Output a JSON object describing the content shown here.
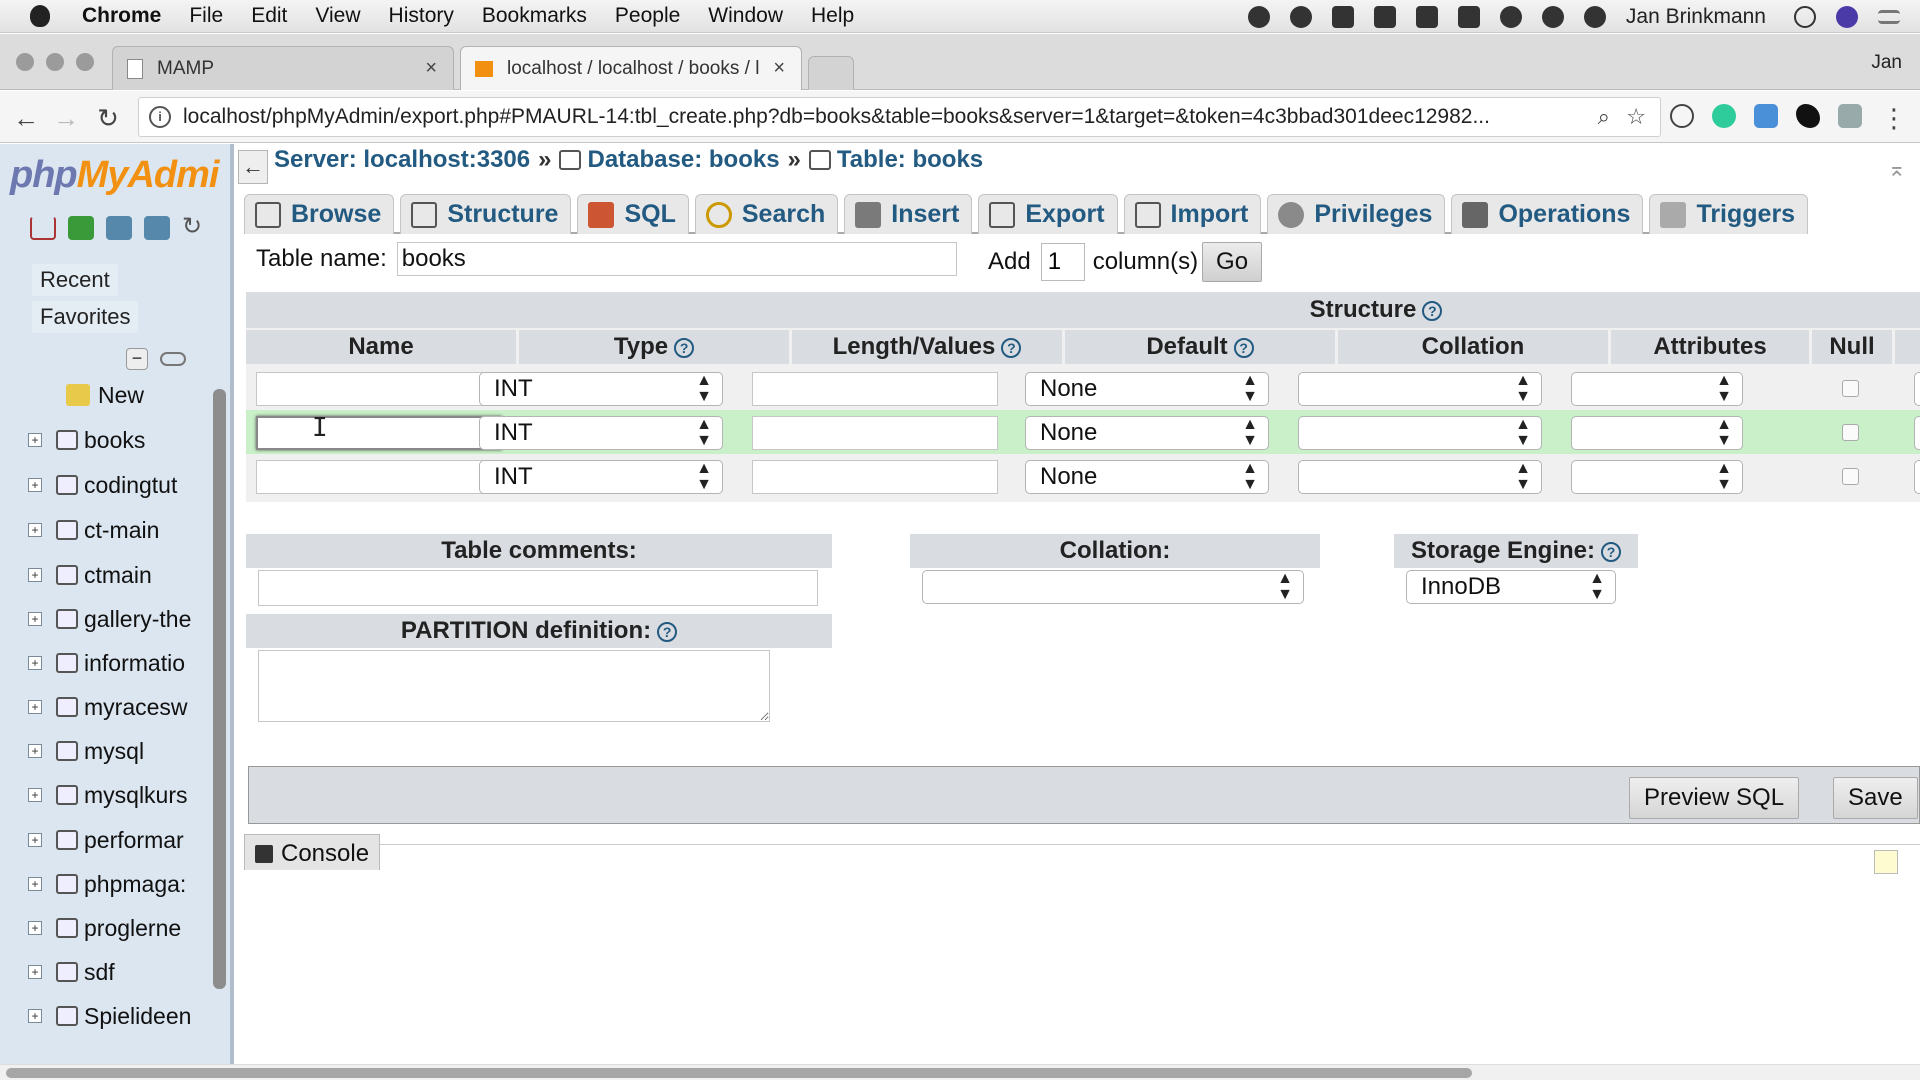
{
  "menubar": {
    "items": [
      "Chrome",
      "File",
      "Edit",
      "View",
      "History",
      "Bookmarks",
      "People",
      "Window",
      "Help"
    ],
    "user": "Jan Brinkmann"
  },
  "browser": {
    "tabs": [
      {
        "title": "MAMP"
      },
      {
        "title": "localhost / localhost / books / l"
      }
    ],
    "profile": "Jan",
    "url": "localhost/phpMyAdmin/export.php#PMAURL-14:tbl_create.php?db=books&table=books&server=1&target=&token=4c3bbad301deec12982..."
  },
  "sidebar": {
    "logo": {
      "php": "php",
      "my": "My",
      "admin": "Admi"
    },
    "recent": "Recent",
    "favorites": "Favorites",
    "new_label": "New",
    "databases": [
      "books",
      "codingtut",
      "ct-main",
      "ctmain",
      "gallery-the",
      "informatio",
      "myracesw",
      "mysql",
      "mysqlkurs",
      "performar",
      "phpmaga:",
      "proglerne",
      "sdf",
      "Spielideen"
    ]
  },
  "breadcrumb": {
    "server": "Server: localhost:3306",
    "database": "Database: books",
    "table": "Table: books",
    "sep": "»"
  },
  "tabs": [
    "Browse",
    "Structure",
    "SQL",
    "Search",
    "Insert",
    "Export",
    "Import",
    "Privileges",
    "Operations",
    "Triggers"
  ],
  "form": {
    "table_name_label": "Table name:",
    "table_name_value": "books",
    "add_label": "Add",
    "add_value": "1",
    "columns_label": "column(s)",
    "go_label": "Go"
  },
  "structure": {
    "title": "Structure",
    "help": "?",
    "headers": [
      "Name",
      "Type",
      "Length/Values",
      "Default",
      "Collation",
      "Attributes",
      "Null"
    ],
    "rows": [
      {
        "name": "",
        "type": "INT",
        "length": "",
        "default": "None",
        "collation": "",
        "attributes": ""
      },
      {
        "name": "",
        "type": "INT",
        "length": "",
        "default": "None",
        "collation": "",
        "attributes": ""
      },
      {
        "name": "",
        "type": "INT",
        "length": "",
        "default": "None",
        "collation": "",
        "attributes": ""
      }
    ]
  },
  "options": {
    "table_comments": "Table comments:",
    "collation": "Collation:",
    "storage_engine": "Storage Engine:",
    "storage_engine_value": "InnoDB",
    "partition": "PARTITION definition:"
  },
  "actions": {
    "preview": "Preview SQL",
    "save": "Save"
  },
  "console": "Console"
}
